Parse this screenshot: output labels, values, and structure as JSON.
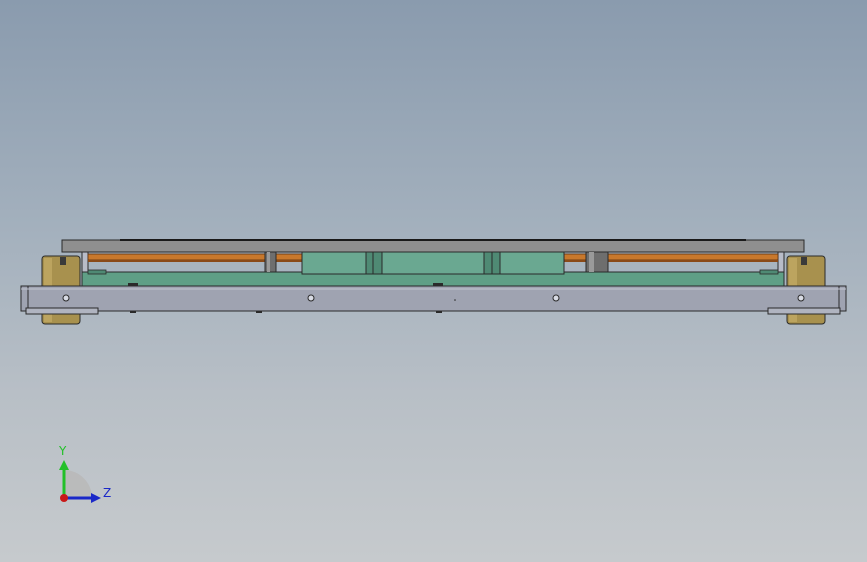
{
  "viewport": {
    "background_top": "#8a9bae",
    "background_bottom": "#c6cacd"
  },
  "model": {
    "colors": {
      "base_frame": "#9fa3b1",
      "green_plate": "#5f9f86",
      "top_plate": "#8f8f8f",
      "copper_strip": "#c8782c",
      "brass_foot": "#a8914e",
      "steel_pin": "#6e6e6e",
      "edge": "#2a2a2a"
    }
  },
  "triad": {
    "y_label": "Y",
    "z_label": "Z",
    "y_color": "#22c028",
    "z_color": "#1a28c8",
    "x_color": "#c81818"
  }
}
